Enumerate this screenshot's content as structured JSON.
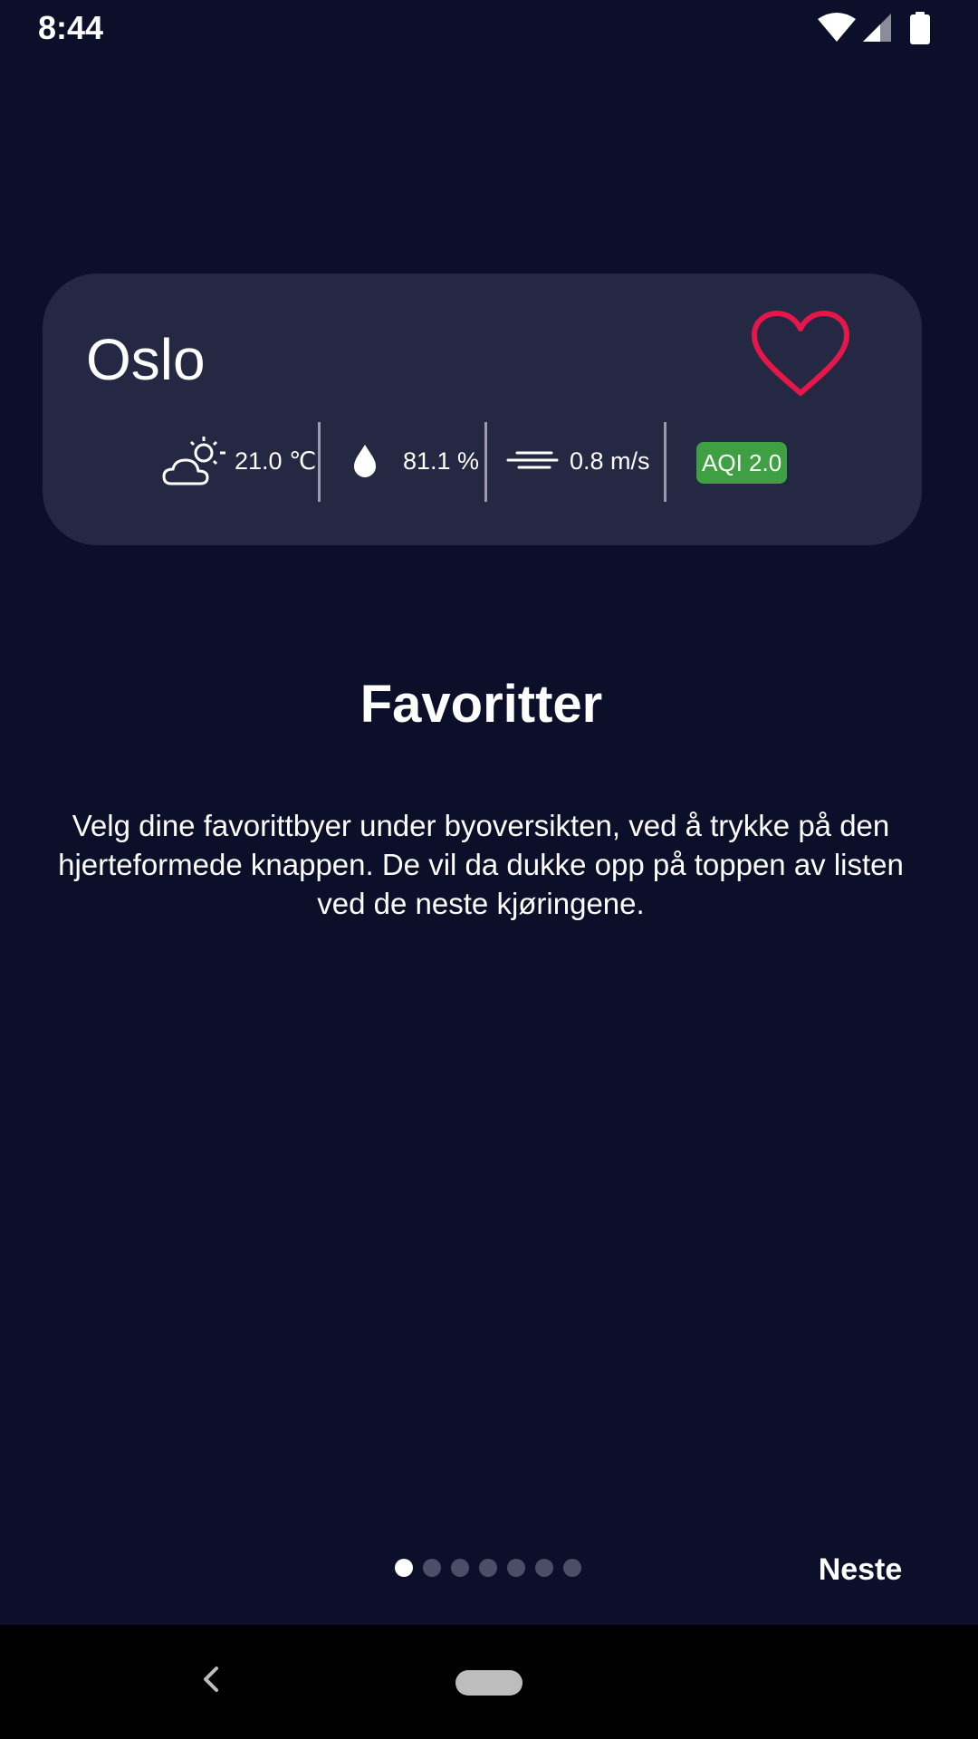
{
  "status_bar": {
    "time": "8:44"
  },
  "card": {
    "city": "Oslo",
    "temperature": "21.0 ℃",
    "humidity": "81.1 %",
    "wind": "0.8 m/s",
    "aqi": "AQI 2.0",
    "weather_icon": "partly-cloudy-icon",
    "humidity_icon": "water-drop-icon",
    "wind_icon": "wind-icon",
    "heart_icon": "heart-outline-icon"
  },
  "colors": {
    "background": "#0c0f2a",
    "card": "#242842",
    "heart": "#e4164a",
    "aqi_badge": "#3ea043"
  },
  "onboarding": {
    "title": "Favoritter",
    "description": "Velg dine favorittbyer under byoversikten, ved å trykke på den hjerteformede knappen. De vil da dukke opp på toppen av listen ved de neste kjøringene."
  },
  "pager": {
    "total_pages": 7,
    "current_page": 1,
    "next_label": "Neste"
  }
}
